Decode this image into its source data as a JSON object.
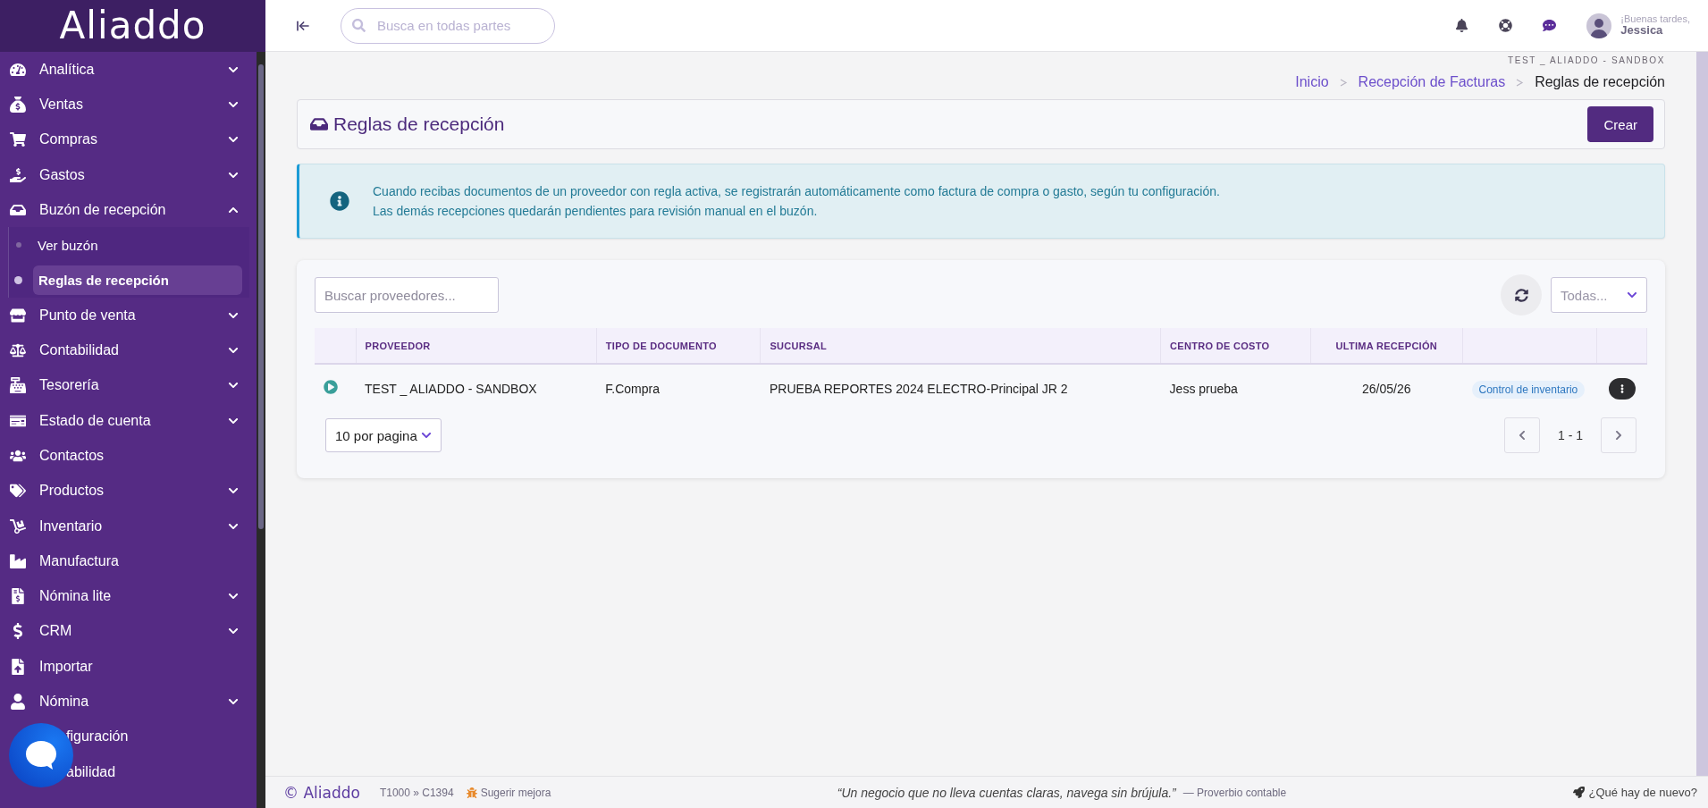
{
  "sidebar": {
    "logo": "Aliaddo",
    "items": [
      {
        "label": "Analítica",
        "kind": "group",
        "expanded": false
      },
      {
        "label": "Ventas",
        "kind": "group",
        "expanded": false
      },
      {
        "label": "Compras",
        "kind": "group",
        "expanded": false
      },
      {
        "label": "Gastos",
        "kind": "group",
        "expanded": false
      },
      {
        "label": "Buzón de recepción",
        "kind": "group",
        "expanded": true,
        "children": [
          {
            "label": "Ver buzón",
            "selected": false
          },
          {
            "label": "Reglas de recepción",
            "selected": true
          }
        ]
      },
      {
        "label": "Punto de venta",
        "kind": "group",
        "expanded": false
      },
      {
        "label": "Contabilidad",
        "kind": "group",
        "expanded": false
      },
      {
        "label": "Tesorería",
        "kind": "group",
        "expanded": false
      },
      {
        "label": "Estado de cuenta",
        "kind": "group",
        "expanded": false
      },
      {
        "label": "Contactos",
        "kind": "link"
      },
      {
        "label": "Productos",
        "kind": "group",
        "expanded": false
      },
      {
        "label": "Inventario",
        "kind": "group",
        "expanded": false
      },
      {
        "label": "Manufactura",
        "kind": "link"
      },
      {
        "label": "Nómina lite",
        "kind": "group",
        "expanded": false
      },
      {
        "label": "CRM",
        "kind": "group",
        "expanded": false
      },
      {
        "label": "Importar",
        "kind": "link"
      },
      {
        "label": "Nómina",
        "kind": "group",
        "expanded": false
      },
      {
        "label": "figuración",
        "kind": "covered"
      },
      {
        "label": "abilidad",
        "kind": "covered"
      }
    ]
  },
  "header": {
    "search": {
      "placeholder": "Busca en todas partes"
    },
    "greeting": "¡Buenas tardes,",
    "user": "Jessica"
  },
  "company": "TEST _ ALIADDO - SANDBOX",
  "breadcrumb": [
    {
      "label": "Inicio",
      "current": false
    },
    {
      "label": "Recepción de Facturas",
      "current": false
    },
    {
      "label": "Reglas de recepción",
      "current": true
    }
  ],
  "page_title": "Reglas de recepción",
  "create_button": "Crear",
  "info": {
    "lines": [
      "Cuando recibas documentos de un proveedor con regla activa, se registrarán automáticamente como factura de compra o gasto, según tu configuración.",
      "Las demás recepciones quedarán pendientes para revisión manual en el buzón."
    ]
  },
  "table_card": {
    "search": {
      "placeholder": "Buscar proveedores..."
    },
    "filter": {
      "placeholder": "Todas..."
    },
    "table": {
      "columns": [
        "PROVEEDOR",
        "TIPO DE DOCUMENTO",
        "SUCURSAL",
        "CENTRO DE COSTO",
        "ULTIMA RECEPCIÓN"
      ],
      "rows": [
        {
          "active": true,
          "cells": [
            "TEST _ ALIADDO - SANDBOX",
            "F.Compra",
            "PRUEBA REPORTES 2024 ELECTRO-Principal JR 2",
            "Jess prueba",
            "26/05/26"
          ],
          "tag": "Control de inventario"
        }
      ]
    },
    "page_size": "10 por pagina",
    "range": "1 - 1"
  },
  "footer": {
    "logo": "© Aliaddo",
    "code": "T1000 » C1394",
    "suggest": "Sugerir mejora",
    "quote": "“Un negocio que no lleva cuentas claras, navega sin brújula.”",
    "quote_source": "— Proverbio contable",
    "news": "¿Qué hay de nuevo?"
  }
}
